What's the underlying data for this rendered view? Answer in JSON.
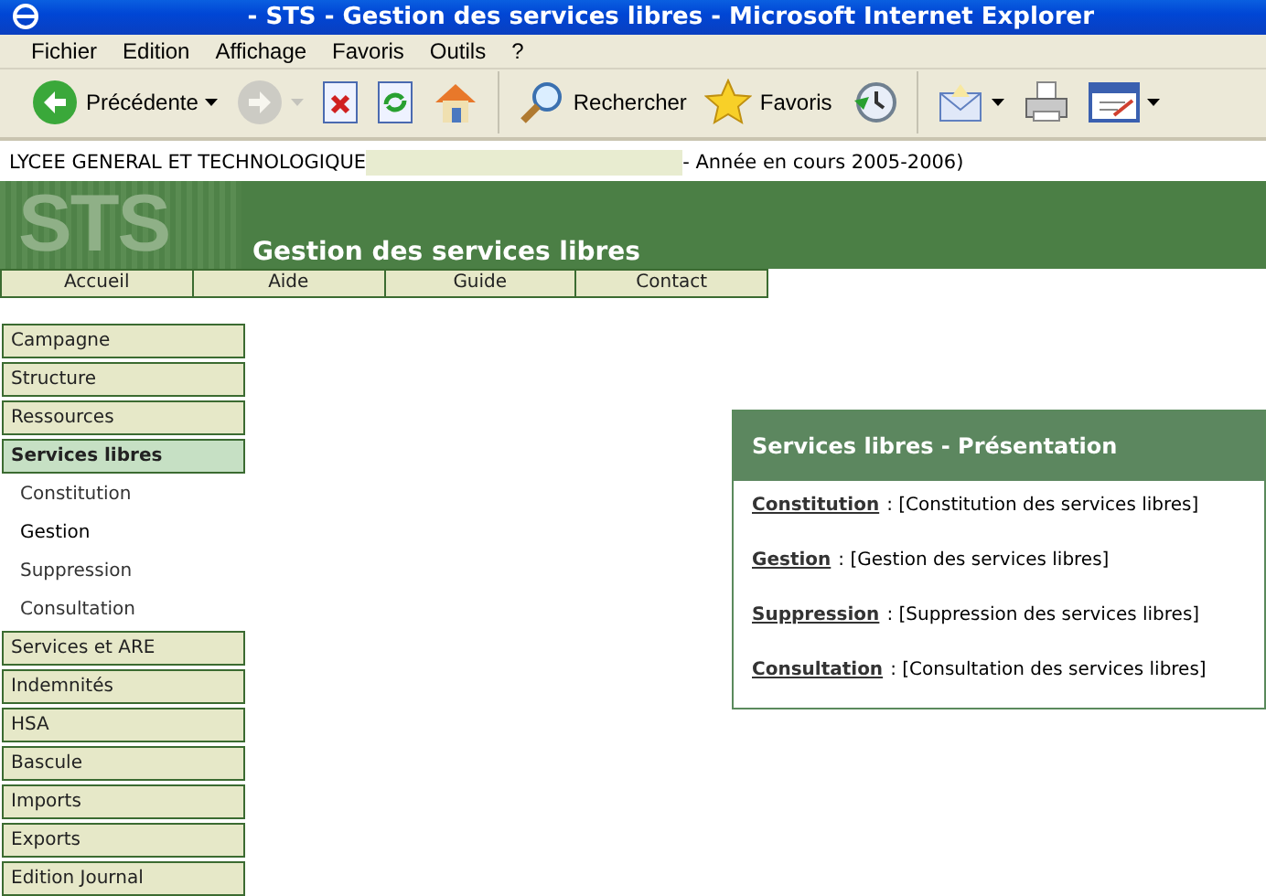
{
  "window": {
    "title": "- STS - Gestion des services libres - Microsoft Internet Explorer"
  },
  "menu": [
    "Fichier",
    "Edition",
    "Affichage",
    "Favoris",
    "Outils",
    "?"
  ],
  "toolbar": [
    {
      "kind": "back",
      "label": "Précédente",
      "dropdown": true,
      "disabled": false
    },
    {
      "kind": "forward",
      "dropdown": true,
      "disabled": true
    },
    {
      "kind": "stop"
    },
    {
      "kind": "refresh"
    },
    {
      "kind": "home"
    },
    {
      "kind": "separator"
    },
    {
      "kind": "search",
      "label": "Rechercher"
    },
    {
      "kind": "favorites",
      "label": "Favoris"
    },
    {
      "kind": "history"
    },
    {
      "kind": "separator"
    },
    {
      "kind": "mail",
      "dropdown": true
    },
    {
      "kind": "print"
    },
    {
      "kind": "edit",
      "dropdown": true
    }
  ],
  "header": {
    "school": "LYCEE GENERAL ET TECHNOLOGIQUE",
    "year": "- Année en cours 2005-2006)"
  },
  "banner": {
    "logo": "STS",
    "title": "Gestion des services libres"
  },
  "nav": [
    "Accueil",
    "Aide",
    "Guide",
    "Contact"
  ],
  "sidebar": {
    "items": [
      {
        "label": "Campagne",
        "selected": false
      },
      {
        "label": "Structure",
        "selected": false
      },
      {
        "label": "Ressources",
        "selected": false
      },
      {
        "label": "Services libres",
        "selected": true,
        "children": [
          {
            "label": "Constitution",
            "selected": false
          },
          {
            "label": "Gestion",
            "selected": true
          },
          {
            "label": "Suppression",
            "selected": false
          },
          {
            "label": "Consultation",
            "selected": false
          }
        ]
      },
      {
        "label": "Services et ARE",
        "selected": false
      },
      {
        "label": "Indemnités",
        "selected": false
      },
      {
        "label": "HSA",
        "selected": false
      },
      {
        "label": "Bascule",
        "selected": false
      },
      {
        "label": "Imports",
        "selected": false
      },
      {
        "label": "Exports",
        "selected": false
      },
      {
        "label": "Edition Journal",
        "selected": false
      }
    ]
  },
  "panel": {
    "title": "Services libres - Présentation",
    "entries": [
      {
        "link": "Constitution",
        "description": ": [Constitution des services libres]"
      },
      {
        "link": "Gestion",
        "description": ": [Gestion des services libres]"
      },
      {
        "link": "Suppression",
        "description": ": [Suppression des services libres]"
      },
      {
        "link": "Consultation",
        "description": ": [Consultation des services libres]"
      }
    ]
  }
}
